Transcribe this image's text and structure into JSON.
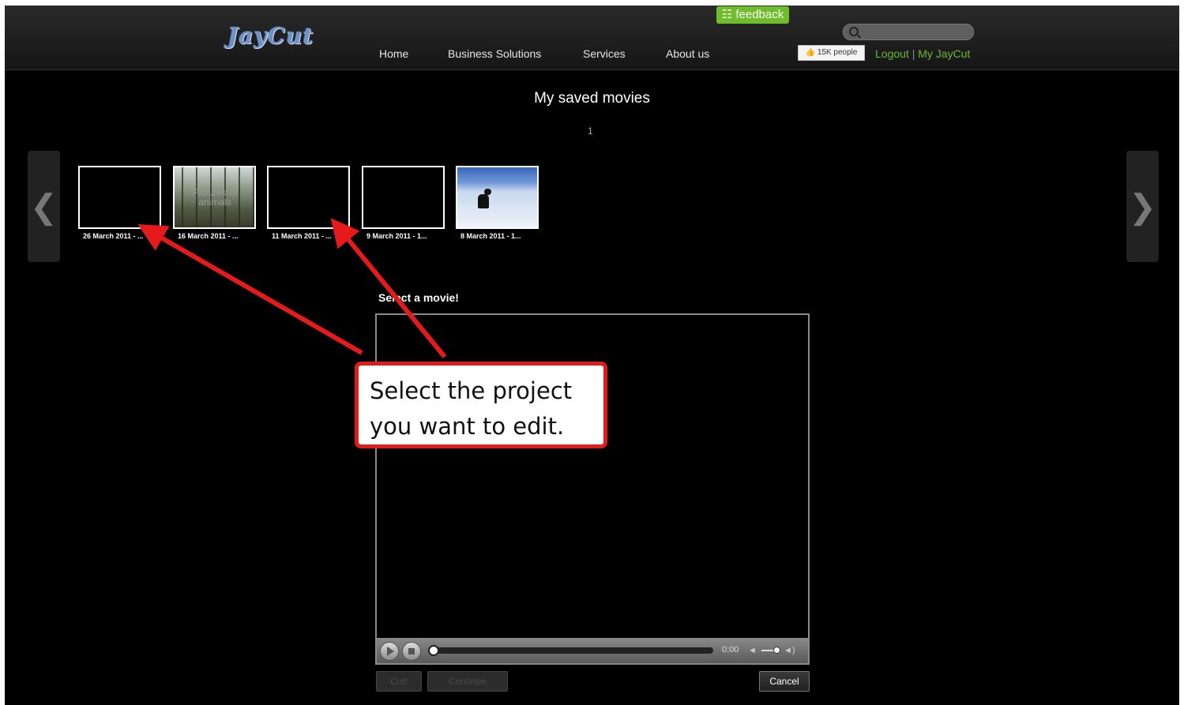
{
  "brand": {
    "logo": "JayCut"
  },
  "nav": {
    "home": "Home",
    "business": "Business Solutions",
    "services": "Services",
    "about": "About us"
  },
  "feedback": {
    "label": "feedback"
  },
  "search": {
    "placeholder": ""
  },
  "like": {
    "label": "15K people"
  },
  "user": {
    "logout": "Logout",
    "separator": "|",
    "my": "My JayCut"
  },
  "page": {
    "title": "My saved movies",
    "page_number": "1"
  },
  "arrows": {
    "left": "❮",
    "right": "❯"
  },
  "movies": [
    {
      "label": "26 March 2011 - ...",
      "thumb": "blank"
    },
    {
      "label": "16 March 2011 - ...",
      "thumb": "forest-photo",
      "overlay": "Pictures of animals"
    },
    {
      "label": "11 March 2011 - ...",
      "thumb": "blank"
    },
    {
      "label": "9 March 2011 - 1...",
      "thumb": "blank"
    },
    {
      "label": "8 March 2011 - 1...",
      "thumb": "snow-dog-photo"
    }
  ],
  "player": {
    "heading": "Select a movie!",
    "time": "0:00",
    "play_icon": "play-icon",
    "stop_icon": "stop-icon",
    "volume_level": 0.8
  },
  "buttons": {
    "a": "Cut!",
    "b": "Continue",
    "cancel": "Cancel"
  },
  "annotation": {
    "text_line1": "Select the project",
    "text_line2": "you want to edit.",
    "color": "#e51b1b"
  }
}
